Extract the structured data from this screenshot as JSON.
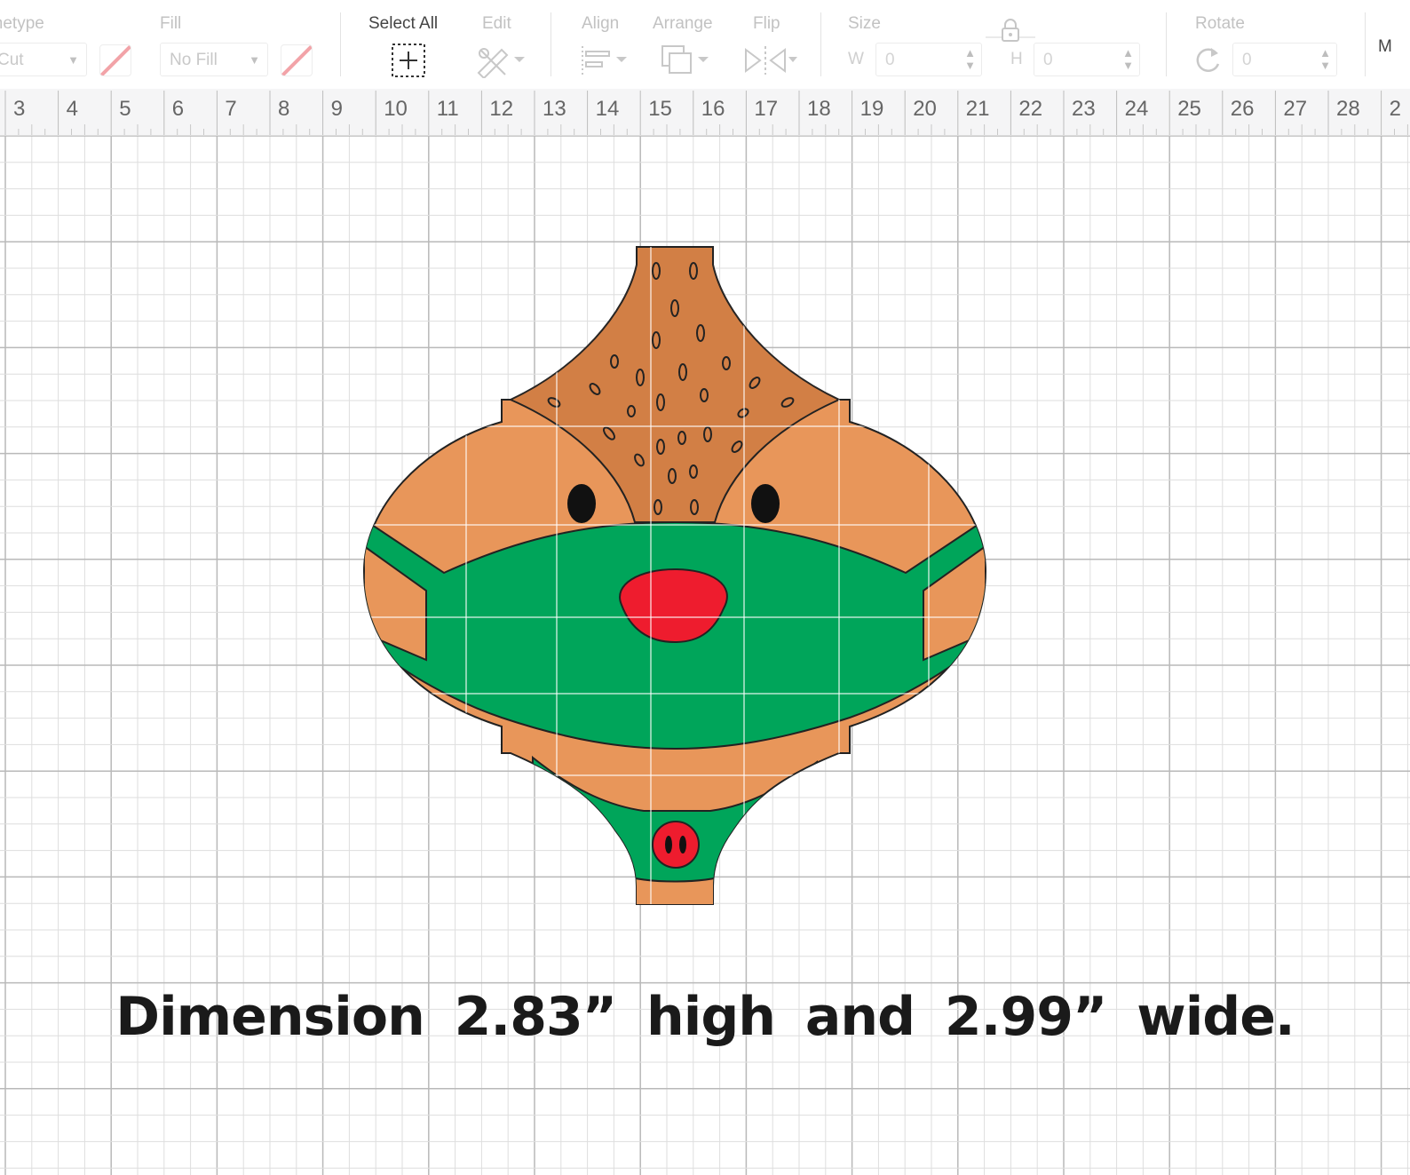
{
  "toolbar": {
    "linetype": {
      "label": "Linetype",
      "value": "Cut"
    },
    "fill": {
      "label": "Fill",
      "value": "No Fill",
      "swatch_color": "#f2a3a8"
    },
    "select_all": {
      "label": "Select All"
    },
    "edit": {
      "label": "Edit"
    },
    "align": {
      "label": "Align"
    },
    "arrange": {
      "label": "Arrange"
    },
    "flip": {
      "label": "Flip"
    },
    "size": {
      "label": "Size",
      "w_letter": "W",
      "w_value": "0",
      "h_letter": "H",
      "h_value": "0"
    },
    "rotate": {
      "label": "Rotate",
      "value": "0"
    },
    "more": {
      "label": "M"
    }
  },
  "ruler": {
    "numbers": [
      "3",
      "4",
      "5",
      "6",
      "7",
      "8",
      "9",
      "10",
      "11",
      "12",
      "13",
      "14",
      "15",
      "16",
      "17",
      "18",
      "19",
      "20",
      "21",
      "22",
      "23",
      "24",
      "25",
      "26",
      "27",
      "28",
      "2"
    ]
  },
  "design": {
    "name": "reindeer-ornament",
    "colors": {
      "head": "#e8965a",
      "fur": "#d27f45",
      "mask": "#00a55a",
      "nose": "#ee1c2e",
      "outline": "#222222",
      "eyes": "#111111"
    }
  },
  "caption": "Dimension 2.83” high and 2.99” wide."
}
